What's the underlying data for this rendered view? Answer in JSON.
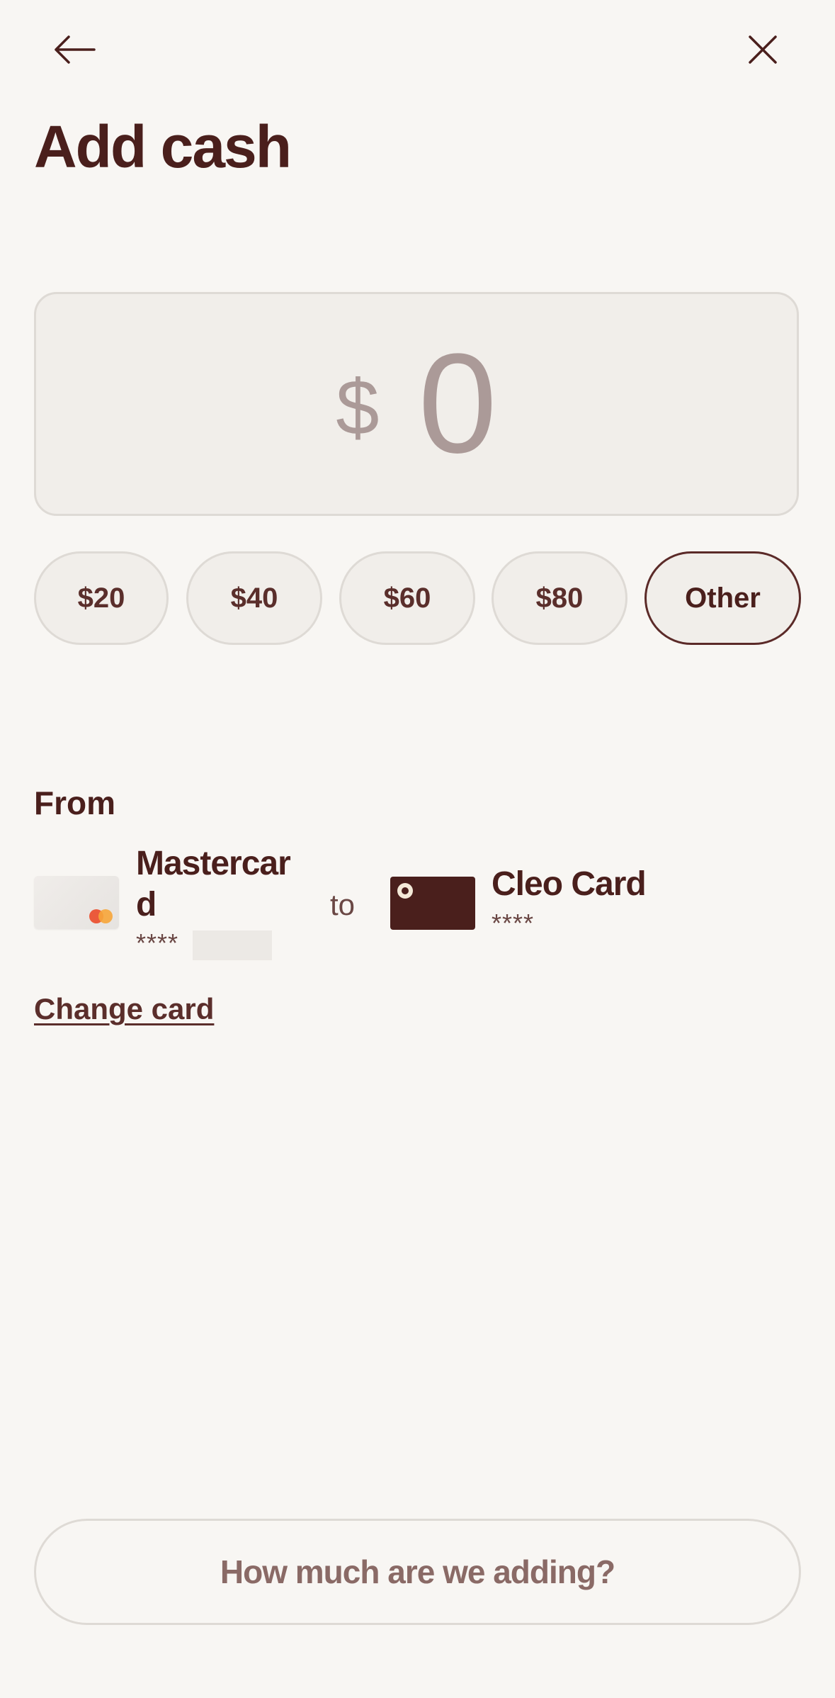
{
  "header": {
    "title": "Add cash",
    "back_icon": "arrow-left-icon",
    "close_icon": "close-icon"
  },
  "amount": {
    "currency_symbol": "$",
    "value": "0"
  },
  "presets": [
    {
      "label": "$20",
      "selected": false
    },
    {
      "label": "$40",
      "selected": false
    },
    {
      "label": "$60",
      "selected": false
    },
    {
      "label": "$80",
      "selected": false
    },
    {
      "label": "Other",
      "selected": true
    }
  ],
  "transfer": {
    "from_label": "From",
    "source": {
      "name": "Mastercard",
      "masked_number": "****",
      "icon": "mastercard-card-icon"
    },
    "to_label": "to",
    "destination": {
      "name": "Cleo Card",
      "masked_number": "****",
      "icon": "cleo-card-icon"
    },
    "change_card_label": "Change card"
  },
  "cta": {
    "label": "How much are we adding?"
  },
  "colors": {
    "background": "#f8f6f3",
    "primary_text": "#4a1f1c",
    "muted_amount": "#ab9a98",
    "chip_background": "#f1eeea",
    "chip_border": "#dedad5",
    "selected_border": "#5b2a28",
    "cta_text": "#8a6a66",
    "mastercard_red": "#eb5a3c",
    "mastercard_orange": "#f7a53a"
  }
}
